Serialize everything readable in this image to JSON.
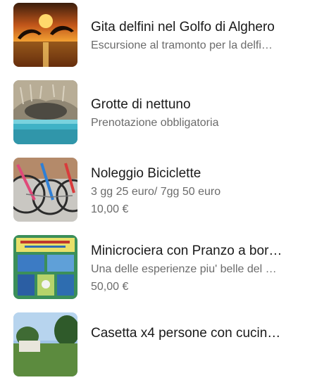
{
  "products": [
    {
      "title": "Gita delfini nel Golfo di Alghero",
      "subtitle": "Escursione al tramonto per la delfi…",
      "image": "dolphins-sunset-photo"
    },
    {
      "title": "Grotte di nettuno",
      "subtitle": "Prenotazione obbligatoria",
      "image": "sea-cave-photo"
    },
    {
      "title": "Noleggio Biciclette",
      "subtitle": "3 gg 25 euro/ 7gg 50 euro",
      "price": "10,00 €",
      "image": "bicycles-photo"
    },
    {
      "title": "Minicrociera con Pranzo a bor…",
      "subtitle": "Una delle esperienze piu' belle del …",
      "price": "50,00 €",
      "image": "cruise-brochure-photo"
    },
    {
      "title": "Casetta x4 persone con cucin…",
      "image": "cottage-photo"
    }
  ],
  "colors": {
    "title": "#1a1a1a",
    "secondary": "#6b6b6b",
    "background": "#ffffff"
  }
}
